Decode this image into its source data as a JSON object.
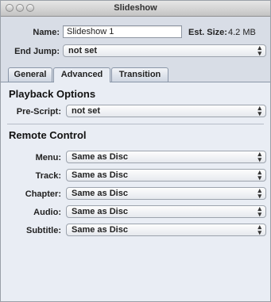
{
  "window": {
    "title": "Slideshow"
  },
  "header": {
    "name_label": "Name:",
    "name_value": "Slideshow 1",
    "est_size_label": "Est. Size:",
    "est_size_value": "4.2 MB",
    "end_jump_label": "End Jump:",
    "end_jump_value": "not set"
  },
  "tabs": [
    {
      "label": "General"
    },
    {
      "label": "Advanced"
    },
    {
      "label": "Transition"
    }
  ],
  "playback": {
    "title": "Playback Options",
    "pre_script_label": "Pre-Script:",
    "pre_script_value": "not set"
  },
  "remote": {
    "title": "Remote Control",
    "items": [
      {
        "label": "Menu:",
        "value": "Same as Disc"
      },
      {
        "label": "Track:",
        "value": "Same as Disc"
      },
      {
        "label": "Chapter:",
        "value": "Same as Disc"
      },
      {
        "label": "Audio:",
        "value": "Same as Disc"
      },
      {
        "label": "Subtitle:",
        "value": "Same as Disc"
      }
    ]
  },
  "icons": {
    "close": "close-icon",
    "minimize": "minimize-icon",
    "zoom": "zoom-icon",
    "popup_arrows": "updown-arrows-icon"
  }
}
